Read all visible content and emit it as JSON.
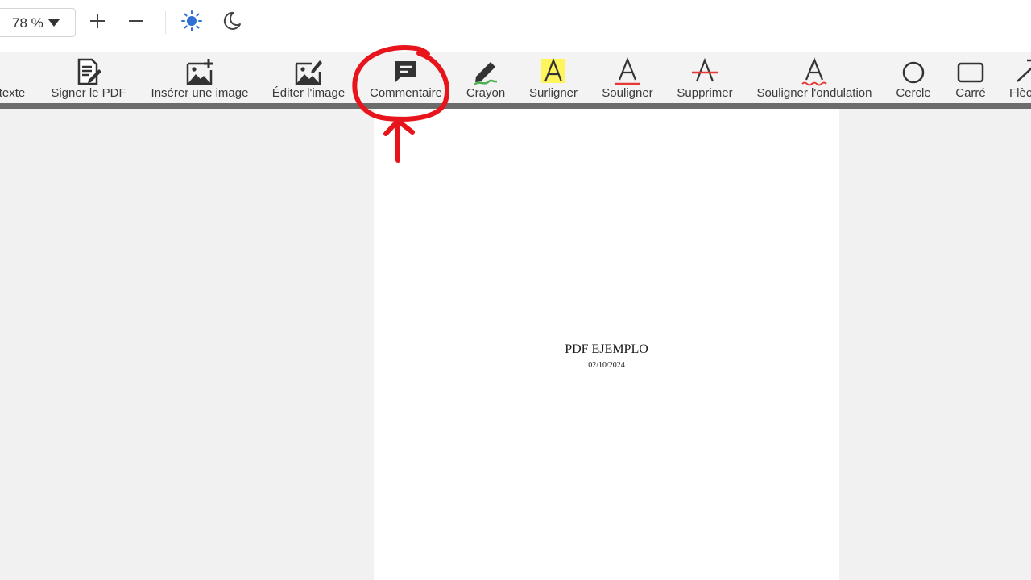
{
  "zoom": {
    "value": "78 %"
  },
  "theme": {
    "light_icon": "sun-icon",
    "dark_icon": "moon-icon"
  },
  "toolbar": {
    "items": [
      {
        "label": "texte",
        "icon": "text-icon"
      },
      {
        "label": "Signer le PDF",
        "icon": "sign-document-icon"
      },
      {
        "label": "Insérer une image",
        "icon": "image-add-icon"
      },
      {
        "label": "Éditer l'image",
        "icon": "image-edit-icon"
      },
      {
        "label": "Commentaire",
        "icon": "comment-icon"
      },
      {
        "label": "Crayon",
        "icon": "pencil-icon"
      },
      {
        "label": "Surligner",
        "icon": "highlight-icon"
      },
      {
        "label": "Souligner",
        "icon": "underline-icon"
      },
      {
        "label": "Supprimer",
        "icon": "strikethrough-icon"
      },
      {
        "label": "Souligner l'ondulation",
        "icon": "wavy-underline-icon"
      },
      {
        "label": "Cercle",
        "icon": "circle-icon"
      },
      {
        "label": "Carré",
        "icon": "square-icon"
      },
      {
        "label": "Flèc",
        "icon": "arrow-icon"
      }
    ]
  },
  "document": {
    "title": "PDF EJEMPLO",
    "date": "02/10/2024"
  },
  "colors": {
    "accent_blue": "#2f6fd6",
    "annotation_red": "#e8141c",
    "highlight_yellow": "#fff45c",
    "underline_red": "#e53935",
    "pencil_green": "#4caf50"
  }
}
